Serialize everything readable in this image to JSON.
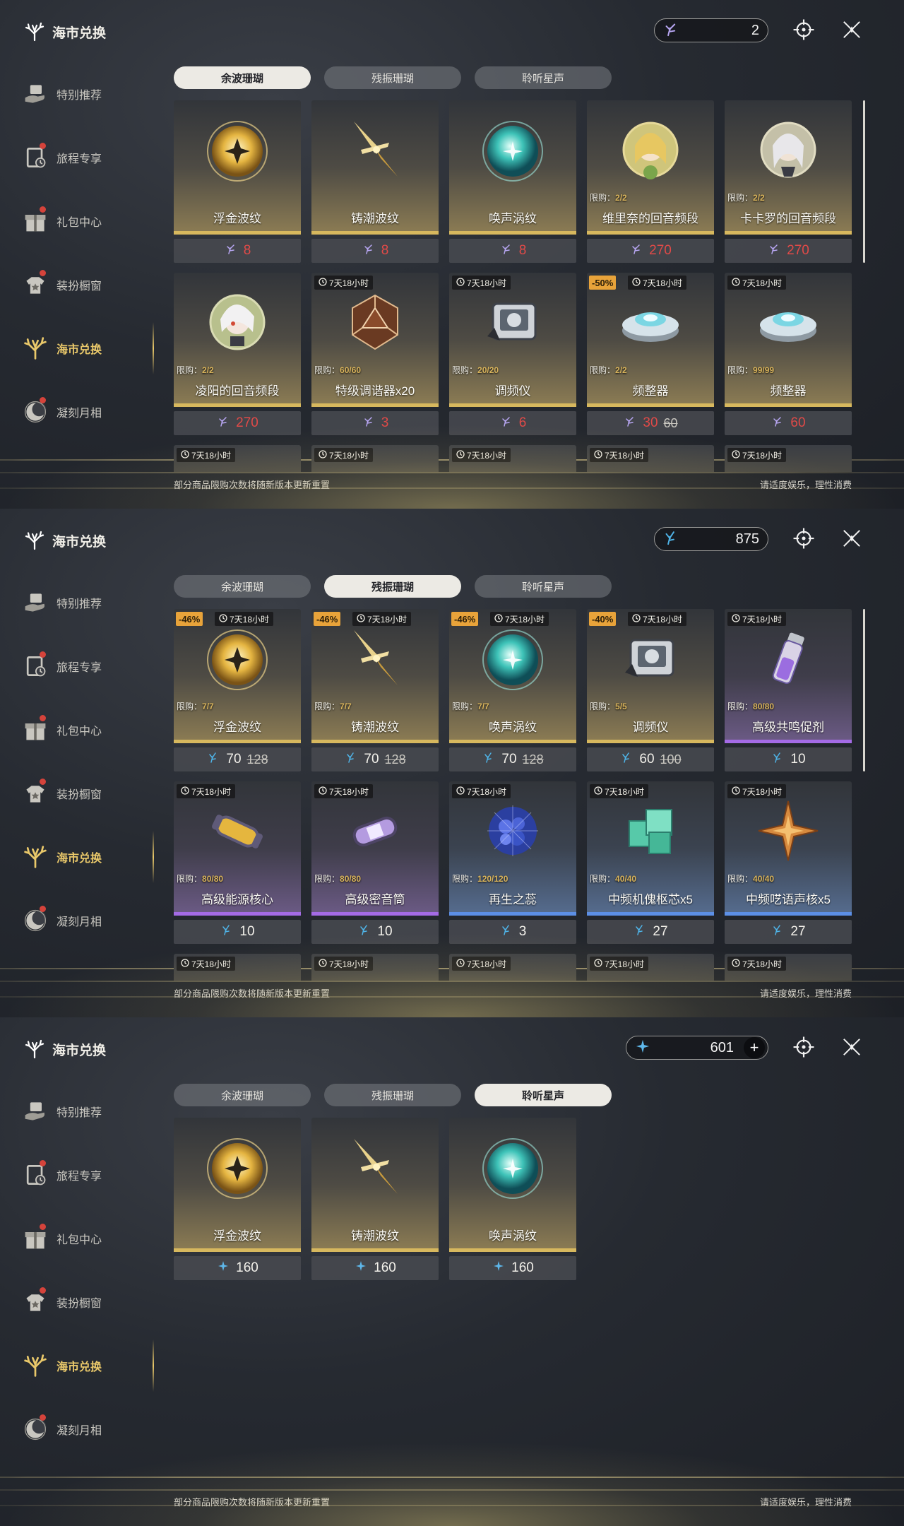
{
  "app": {
    "title": "海市兑换"
  },
  "sidebar": {
    "items": [
      {
        "label": "特别推荐",
        "icon": "hand-gift-icon",
        "dot": false,
        "active": false
      },
      {
        "label": "旅程专享",
        "icon": "journey-icon",
        "dot": true,
        "active": false
      },
      {
        "label": "礼包中心",
        "icon": "gift-box-icon",
        "dot": true,
        "active": false
      },
      {
        "label": "装扮橱窗",
        "icon": "wardrobe-icon",
        "dot": true,
        "active": false
      },
      {
        "label": "海市兑换",
        "icon": "coral-icon",
        "dot": false,
        "active": true
      },
      {
        "label": "凝刻月相",
        "icon": "moon-icon",
        "dot": true,
        "active": false
      }
    ]
  },
  "tabs": [
    "余波珊瑚",
    "残振珊瑚",
    "聆听星声"
  ],
  "footer": {
    "left": "部分商品限购次数将随新版本更新重置",
    "right": "请适度娱乐，理性消费"
  },
  "panels": [
    {
      "active_tab": 0,
      "currency": {
        "icon": "afterglow-coral-icon",
        "amount": "2",
        "plus": false
      },
      "price_style": "red",
      "peek_timer": "7天18小时",
      "items": [
        {
          "name": "浮金波纹",
          "price": "8",
          "art": "gold-orb",
          "rarity": "gold"
        },
        {
          "name": "铸潮波纹",
          "price": "8",
          "art": "gold-blade",
          "rarity": "gold"
        },
        {
          "name": "唤声涡纹",
          "price": "8",
          "art": "teal-orb",
          "rarity": "gold"
        },
        {
          "name": "维里奈的回音频段",
          "price": "270",
          "art": "portrait-blonde",
          "rarity": "gold",
          "limit": "2/2"
        },
        {
          "name": "卡卡罗的回音频段",
          "price": "270",
          "art": "portrait-silver",
          "rarity": "gold",
          "limit": "2/2"
        },
        {
          "name": "凌阳的回音频段",
          "price": "270",
          "art": "portrait-white",
          "rarity": "gold",
          "limit": "2/2"
        },
        {
          "name": "特级调谐器x20",
          "price": "3",
          "art": "d20",
          "rarity": "gold",
          "limit": "60/60",
          "timer": "7天18小时"
        },
        {
          "name": "调频仪",
          "price": "6",
          "art": "device",
          "rarity": "gold",
          "limit": "20/20",
          "timer": "7天18小时"
        },
        {
          "name": "频整器",
          "price": "30",
          "old": "60",
          "discount": "-50%",
          "art": "disc",
          "rarity": "gold",
          "limit": "2/2",
          "timer": "7天18小时"
        },
        {
          "name": "频整器",
          "price": "60",
          "art": "disc",
          "rarity": "gold",
          "limit": "99/99",
          "timer": "7天18小时"
        }
      ]
    },
    {
      "active_tab": 1,
      "currency": {
        "icon": "oscillated-coral-icon",
        "amount": "875",
        "plus": false
      },
      "price_style": "white",
      "peek_timer": "7天18小时",
      "items": [
        {
          "name": "浮金波纹",
          "price": "70",
          "old": "128",
          "discount": "-46%",
          "art": "gold-orb",
          "rarity": "gold",
          "limit": "7/7",
          "timer": "7天18小时"
        },
        {
          "name": "铸潮波纹",
          "price": "70",
          "old": "128",
          "discount": "-46%",
          "art": "gold-blade",
          "rarity": "gold",
          "limit": "7/7",
          "timer": "7天18小时"
        },
        {
          "name": "唤声涡纹",
          "price": "70",
          "old": "128",
          "discount": "-46%",
          "art": "teal-orb",
          "rarity": "gold",
          "limit": "7/7",
          "timer": "7天18小时"
        },
        {
          "name": "调频仪",
          "price": "60",
          "old": "100",
          "discount": "-40%",
          "art": "device",
          "rarity": "gold",
          "limit": "5/5",
          "timer": "7天18小时"
        },
        {
          "name": "高级共鸣促剂",
          "price": "10",
          "art": "vial",
          "rarity": "purple",
          "limit": "80/80",
          "timer": "7天18小时"
        },
        {
          "name": "高级能源核心",
          "price": "10",
          "art": "core-gold",
          "rarity": "purple",
          "limit": "80/80",
          "timer": "7天18小时"
        },
        {
          "name": "高级密音筒",
          "price": "10",
          "art": "core-purple",
          "rarity": "purple",
          "limit": "80/80",
          "timer": "7天18小时"
        },
        {
          "name": "再生之蕊",
          "price": "3",
          "art": "blue-cluster",
          "rarity": "blue",
          "limit": "120/120",
          "timer": "7天18小时"
        },
        {
          "name": "中频机傀枢芯x5",
          "price": "27",
          "art": "green-cubes",
          "rarity": "blue",
          "limit": "40/40",
          "timer": "7天18小时"
        },
        {
          "name": "中频呓语声核x5",
          "price": "27",
          "art": "star-core",
          "rarity": "blue",
          "limit": "40/40",
          "timer": "7天18小时"
        }
      ]
    },
    {
      "active_tab": 2,
      "currency": {
        "icon": "lustrous-tide-icon",
        "amount": "601",
        "plus": true
      },
      "price_style": "white",
      "items": [
        {
          "name": "浮金波纹",
          "price": "160",
          "art": "gold-orb",
          "rarity": "gold"
        },
        {
          "name": "铸潮波纹",
          "price": "160",
          "art": "gold-blade",
          "rarity": "gold"
        },
        {
          "name": "唤声涡纹",
          "price": "160",
          "art": "teal-orb",
          "rarity": "gold"
        }
      ]
    }
  ]
}
